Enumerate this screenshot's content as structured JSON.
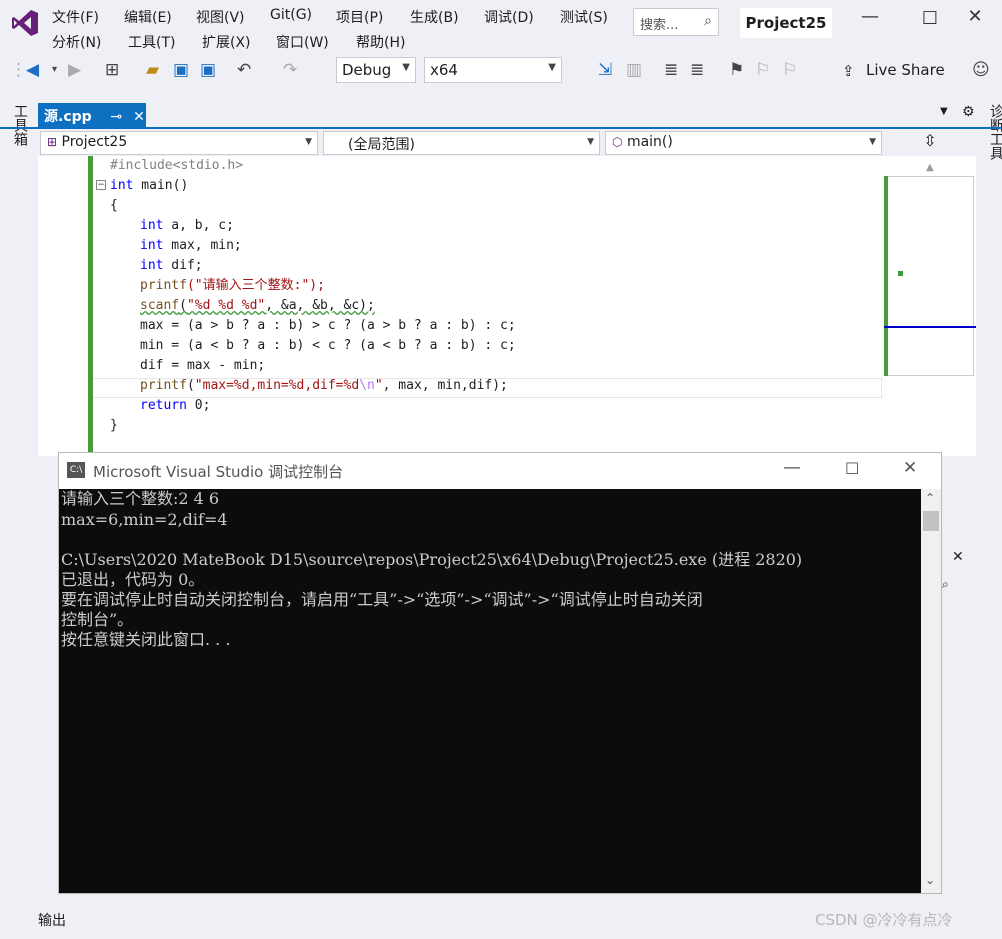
{
  "menu": {
    "row1": [
      "文件(F)",
      "编辑(E)",
      "视图(V)",
      "Git(G)",
      "项目(P)",
      "生成(B)",
      "调试(D)",
      "测试(S)"
    ],
    "row2": [
      "分析(N)",
      "工具(T)",
      "扩展(X)",
      "窗口(W)",
      "帮助(H)"
    ]
  },
  "search": {
    "placeholder": "搜索..."
  },
  "project_title": "Project25",
  "toolbar": {
    "config": "Debug",
    "platform": "x64",
    "live_share": "Live Share"
  },
  "left_toolbox": "工具箱",
  "right_diag": "诊断工具",
  "tab": {
    "name": "源.cpp"
  },
  "nav": {
    "project": "Project25",
    "scope": "(全局范围)",
    "member": "main()"
  },
  "code": {
    "l1": "#include<stdio.h>",
    "l2_kw": "int",
    "l2_rest": " main()",
    "l3": "{",
    "l4_kw": "int",
    "l4_rest": " a, b, c;",
    "l5_kw": "int",
    "l5_rest": " max, min;",
    "l6_kw": "int",
    "l6_rest": " dif;",
    "l7_fn": "printf",
    "l7_str": "(\"请输入三个整数:\");",
    "l8_fn": "scanf",
    "l8_a": "(",
    "l8_str": "\"%d %d %d\"",
    "l8_rest": ", &a, &b, &c);",
    "l9": "max = (a > b ? a : b) > c ? (a > b ? a : b) : c;",
    "l10": "min = (a < b ? a : b) < c ? (a < b ? a : b) : c;",
    "l11": "dif = max - min;",
    "l12_fn": "printf",
    "l12_a": "(",
    "l12_str": "\"max=%d,min=%d,dif=%d",
    "l12_esc": "\\n",
    "l12_str2": "\"",
    "l12_rest": ", max, min,dif);",
    "l13_kw": "return",
    "l13_rest": " 0;",
    "l14": "}"
  },
  "console": {
    "title": "Microsoft Visual Studio 调试控制台",
    "lines": [
      "请输入三个整数:2 4 6",
      "max=6,min=2,dif=4",
      "",
      "C:\\Users\\2020 MateBook D15\\source\\repos\\Project25\\x64\\Debug\\Project25.exe (进程 2820)",
      "已退出，代码为 0。",
      "要在调试停止时自动关闭控制台，请启用“工具”->“选项”->“调试”->“调试停止时自动关闭",
      "控制台”。",
      "按任意键关闭此窗口. . ."
    ]
  },
  "output_label": "输出",
  "watermark": "CSDN @冷冷有点冷",
  "colors": {
    "accent": "#0e70c0",
    "vs_purple": "#68217a",
    "console_bg": "#0c0c0c",
    "green_bar": "#4a9a3c"
  }
}
